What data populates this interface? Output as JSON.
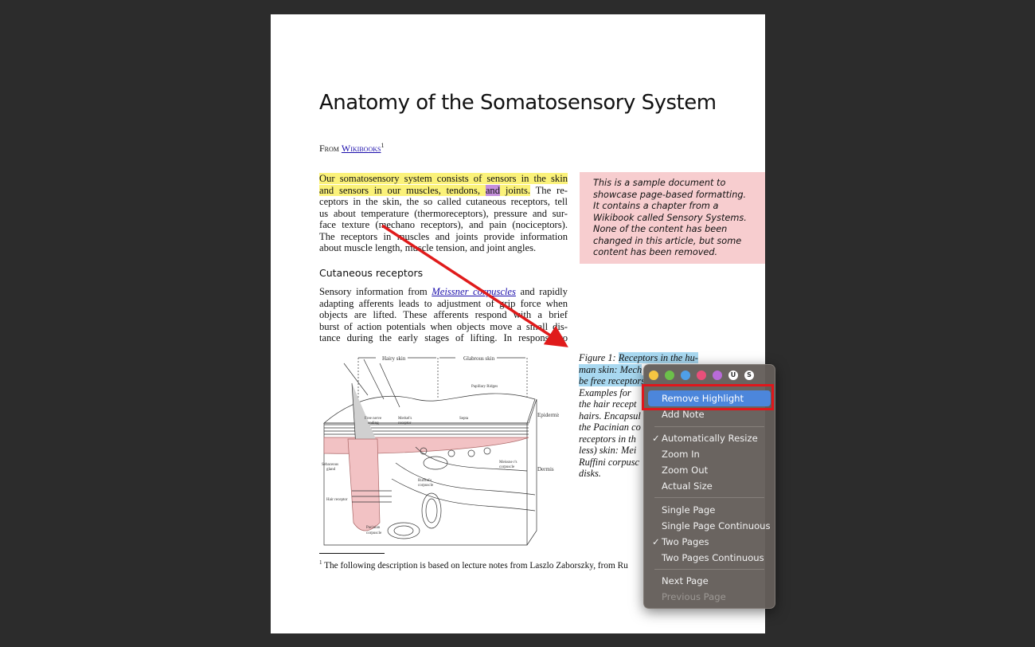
{
  "document": {
    "title": "Anatomy of the Somatosensory System",
    "from_label": "From",
    "from_link": "Wikibooks",
    "from_sup": "1",
    "intro": {
      "line0": "Our somatosensory system consists of sensors in the skin",
      "line1_a": "and sensors in our muscles, tendons,",
      "line1_b": "and",
      "line1_c": "joints.",
      "line1_d": "The re-",
      "lines": [
        "ceptors in the skin, the so called cutaneous receptors, tell",
        "us about temperature (thermoreceptors), pressure and sur-",
        "face texture (mechano receptors), and pain (nociceptors).",
        "The receptors in muscles and joints provide information",
        "about muscle length, muscle tension, and joint angles."
      ]
    },
    "section_heading": "Cutaneous receptors",
    "section": {
      "line0_a": "Sensory information from",
      "line0_link": "Meissner corpuscles",
      "line0_b": "and rapidly",
      "lines": [
        "adapting afferents leads to adjustment of grip force when",
        "objects are lifted. These afferents respond with a brief",
        "burst of action potentials when objects move a small dis-",
        "tance during the early stages of lifting. In response to"
      ]
    },
    "sidebar_note": "This is a sample document to showcase page-based formatting. It contains a chapter from a Wikibook called Sensory Systems. None of the content has been changed in this article, but some content has been removed.",
    "figure": {
      "labels": {
        "hairy_skin": "Hairy skin",
        "glabrous_skin": "Glabrous skin",
        "papillary_ridges": "Papillary Ridges",
        "septa": "Septa",
        "epidermis": "Epidermis",
        "dermis": "Dermis",
        "free_nerve": "Free nerve",
        "ending": "ending",
        "merkel": "Merkel's",
        "receptor": "receptor",
        "sebaceous": "Sebaceous",
        "gland": "gland",
        "ruffini": "Ruffini's",
        "corpuscle": "corpuscle",
        "meissner": "Meissne r's",
        "hair_receptor": "Hair receptor",
        "pacinian": "Pacinian"
      },
      "caption_a": "Figure 1:",
      "caption_hl": "Receptors in the hu-",
      "caption_lines_hl": [
        "man skin: Mech",
        "be free receptors"
      ],
      "caption_lines": [
        "Examples for",
        "the hair recept",
        "hairs. Encapsul",
        "the Pacinian co",
        "receptors in th",
        "less) skin: Mei",
        "Ruffini corpusc",
        "disks."
      ]
    },
    "footnote_sup": "1",
    "footnote": "The following description is based on lecture notes from Laszlo Zaborszky, from Ru"
  },
  "context_menu": {
    "highlight_colors": [
      "#f5c542",
      "#6cc04a",
      "#4f9fe8",
      "#e8507a",
      "#b86bd8"
    ],
    "underline_label": "U",
    "strike_label": "S",
    "items": [
      {
        "label": "Remove Highlight",
        "selected": true
      },
      {
        "label": "Add Note"
      },
      {
        "label": "Automatically Resize",
        "checked": true
      },
      {
        "label": "Zoom In"
      },
      {
        "label": "Zoom Out"
      },
      {
        "label": "Actual Size"
      },
      {
        "label": "Single Page"
      },
      {
        "label": "Single Page Continuous"
      },
      {
        "label": "Two Pages",
        "checked": true
      },
      {
        "label": "Two Pages Continuous"
      },
      {
        "label": "Next Page"
      },
      {
        "label": "Previous Page",
        "disabled": true
      }
    ],
    "check_glyph": "✓"
  },
  "annotation": {
    "arrow_color": "#e01b1b",
    "box_color": "#e0161b"
  }
}
